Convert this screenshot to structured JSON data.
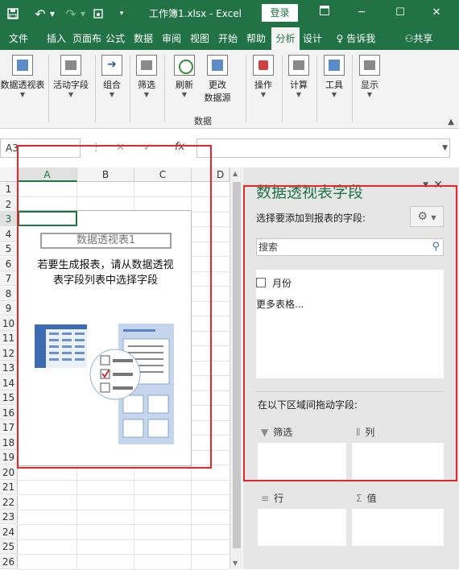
{
  "titlebar": {
    "undo": "↶",
    "redo": "↷",
    "filename": "工作簿1.xlsx",
    "app": "Excel",
    "login": "登录",
    "minimize": "─",
    "maximize": "☐",
    "close": "✕"
  },
  "tabs": [
    "文件",
    "插入",
    "页面布",
    "公式",
    "数据",
    "审阅",
    "视图",
    "开始",
    "帮助",
    "分析",
    "设计"
  ],
  "tab_tell": "告诉我",
  "tab_share": "共享",
  "ribbon": {
    "pivot_table": "数据透视表",
    "active_field": "活动字段",
    "group": "组合",
    "filter": "筛选",
    "refresh": "刷新",
    "change_source_1": "更改",
    "change_source_2": "数据源",
    "group_data": "数据",
    "actions": "操作",
    "calculations": "计算",
    "tools": "工具",
    "show": "显示"
  },
  "formula": {
    "namebox": "A3",
    "fx": "fx",
    "cancel": "✕",
    "enter": "✓"
  },
  "grid": {
    "columns": [
      "A",
      "B",
      "C",
      "D"
    ],
    "rows": [
      "1",
      "2",
      "3",
      "4",
      "5",
      "6",
      "7",
      "8",
      "9",
      "10",
      "11",
      "12",
      "13",
      "14",
      "15",
      "16",
      "17",
      "18",
      "19",
      "20",
      "21",
      "22",
      "23",
      "24",
      "25",
      "26"
    ]
  },
  "pivot": {
    "name": "数据透视表1",
    "message_line1": "若要生成报表，请从数据透视",
    "message_line2": "表字段列表中选择字段"
  },
  "pane": {
    "title": "数据透视表字段",
    "choose_fields": "选择要添加到报表的字段:",
    "search_placeholder": "搜索",
    "field_month": "月份",
    "more_tables": "更多表格...",
    "drag_fields": "在以下区域间拖动字段:",
    "area_filter": "筛选",
    "area_columns": "列",
    "area_rows": "行",
    "area_values": "值"
  },
  "colors": {
    "excel_green": "#217346",
    "highlight_red": "#e8262a"
  }
}
